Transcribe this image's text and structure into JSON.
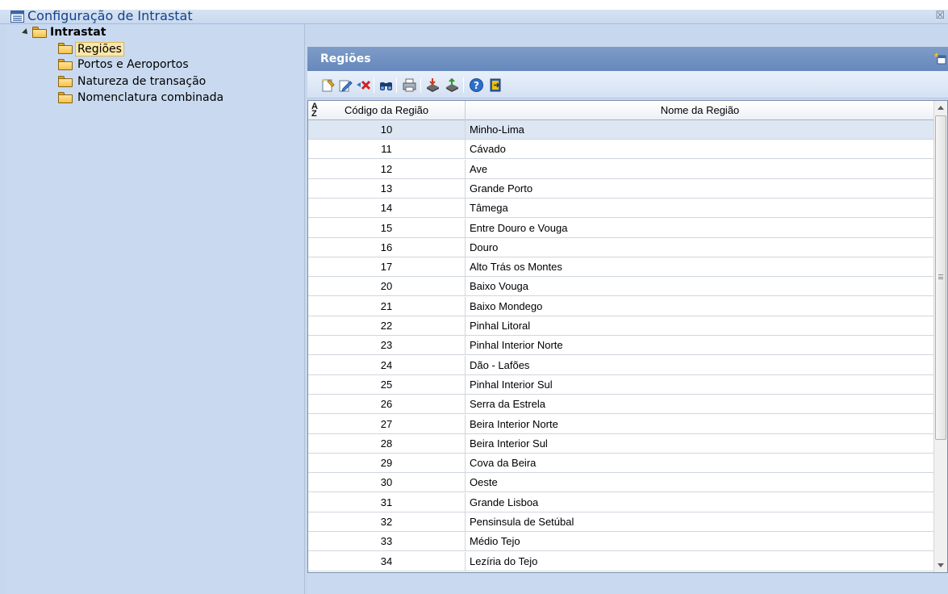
{
  "window": {
    "title": "Configuração de Intrastat"
  },
  "tree": {
    "root": "Intrastat",
    "items": [
      {
        "label": "Regiões"
      },
      {
        "label": "Portos e Aeroportos"
      },
      {
        "label": "Natureza de transação"
      },
      {
        "label": "Nomenclatura combinada"
      }
    ]
  },
  "panel": {
    "title": "Regiões"
  },
  "toolbar": {
    "icons": [
      "new-record-icon",
      "edit-record-icon",
      "delete-record-icon",
      "find-icon",
      "print-icon",
      "import-icon",
      "export-icon",
      "help-icon",
      "exit-icon"
    ]
  },
  "grid": {
    "columns": [
      "Código da Região",
      "Nome da Região"
    ],
    "rows": [
      [
        "10",
        "Minho-Lima"
      ],
      [
        "11",
        "Cávado"
      ],
      [
        "12",
        "Ave"
      ],
      [
        "13",
        "Grande Porto"
      ],
      [
        "14",
        "Tâmega"
      ],
      [
        "15",
        "Entre Douro e Vouga"
      ],
      [
        "16",
        "Douro"
      ],
      [
        "17",
        "Alto Trás os Montes"
      ],
      [
        "20",
        "Baixo Vouga"
      ],
      [
        "21",
        "Baixo Mondego"
      ],
      [
        "22",
        "Pinhal Litoral"
      ],
      [
        "23",
        "Pinhal Interior Norte"
      ],
      [
        "24",
        "Dão - Lafões"
      ],
      [
        "25",
        "Pinhal Interior Sul"
      ],
      [
        "26",
        "Serra da Estrela"
      ],
      [
        "27",
        "Beira Interior Norte"
      ],
      [
        "28",
        "Beira Interior Sul"
      ],
      [
        "29",
        "Cova da Beira"
      ],
      [
        "30",
        "Oeste"
      ],
      [
        "31",
        "Grande Lisboa"
      ],
      [
        "32",
        "Pensinsula de Setúbal"
      ],
      [
        "33",
        "Médio Tejo"
      ],
      [
        "34",
        "Lezíria do Tejo"
      ]
    ]
  },
  "colors": {
    "accent": "#15428b",
    "panel_header": "#6f8fc2",
    "selection": "#fbe7a8"
  }
}
